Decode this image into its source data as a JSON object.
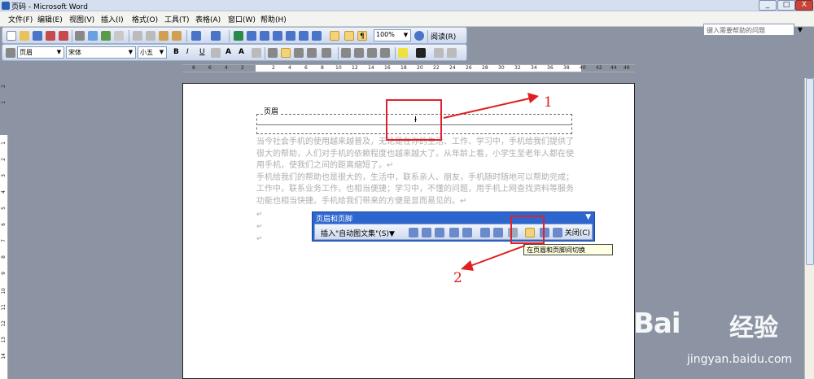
{
  "window": {
    "title": "页码 - Microsoft Word",
    "min": "_",
    "max": "□",
    "close": "X"
  },
  "menu": {
    "items": [
      "文件(F)",
      "编辑(E)",
      "视图(V)",
      "插入(I)",
      "格式(O)",
      "工具(T)",
      "表格(A)",
      "窗口(W)",
      "帮助(H)"
    ],
    "help_placeholder": "键入需要帮助的问题",
    "help_arrow": "▼"
  },
  "toolbar": {
    "zoom": "100%",
    "read": "阅读(R)",
    "arrow": "▼",
    "pilcrow": "¶"
  },
  "format_toolbar": {
    "style": "页眉",
    "font": "宋体",
    "size": "小五",
    "bold": "B",
    "italic": "I",
    "underline": "U",
    "charA": "A",
    "charA2": "A",
    "arrow": "▼"
  },
  "ruler": {
    "h": [
      "8",
      "6",
      "4",
      "2",
      "2",
      "4",
      "6",
      "8",
      "10",
      "12",
      "14",
      "16",
      "18",
      "20",
      "22",
      "24",
      "26",
      "28",
      "30",
      "32",
      "34",
      "36",
      "38",
      "40",
      "42",
      "44",
      "46"
    ],
    "v": [
      "2",
      "1",
      "1",
      "2",
      "3",
      "4",
      "5",
      "6",
      "7",
      "8",
      "9",
      "10",
      "11",
      "12",
      "13",
      "14",
      "15",
      "16",
      "17",
      "18",
      "19",
      "20",
      "21",
      "22",
      "23",
      "24",
      "25"
    ]
  },
  "document": {
    "header_label": "页眉",
    "paragraphs": [
      "当今社会手机的使用越来越普及，无论是在你的生活、工作、学习中，手机给我们提供了很大的帮助，人们对手机的依赖程度也越来越大了。从年龄上看，小学生至老年人都在使用手机，使我们之间的距离缩短了。↵",
      "手机给我们的帮助也是很大的，生活中，联系亲人、朋友，手机随时随地可以帮助完成；工作中，联系业务工作，也相当便捷；学习中，不懂的问题，用手机上网查找资料等服务功能也相当快捷。手机给我们带来的方便是显而易见的。↵"
    ],
    "empty_marks": [
      "↵",
      "↵",
      "↵"
    ]
  },
  "header_toolbar": {
    "title": "页眉和页脚",
    "insert_autotext": "插入\"自动图文集\"(S)▼",
    "close": "关闭(C)",
    "arrow": "▼"
  },
  "tooltip": "在页眉和页脚间切换",
  "annotations": {
    "num1": "1",
    "num2": "2",
    "color": "#e0202a"
  },
  "watermark": {
    "baidu": "Bai",
    "jingyan": "经验",
    "url": "jingyan.baidu.com"
  }
}
